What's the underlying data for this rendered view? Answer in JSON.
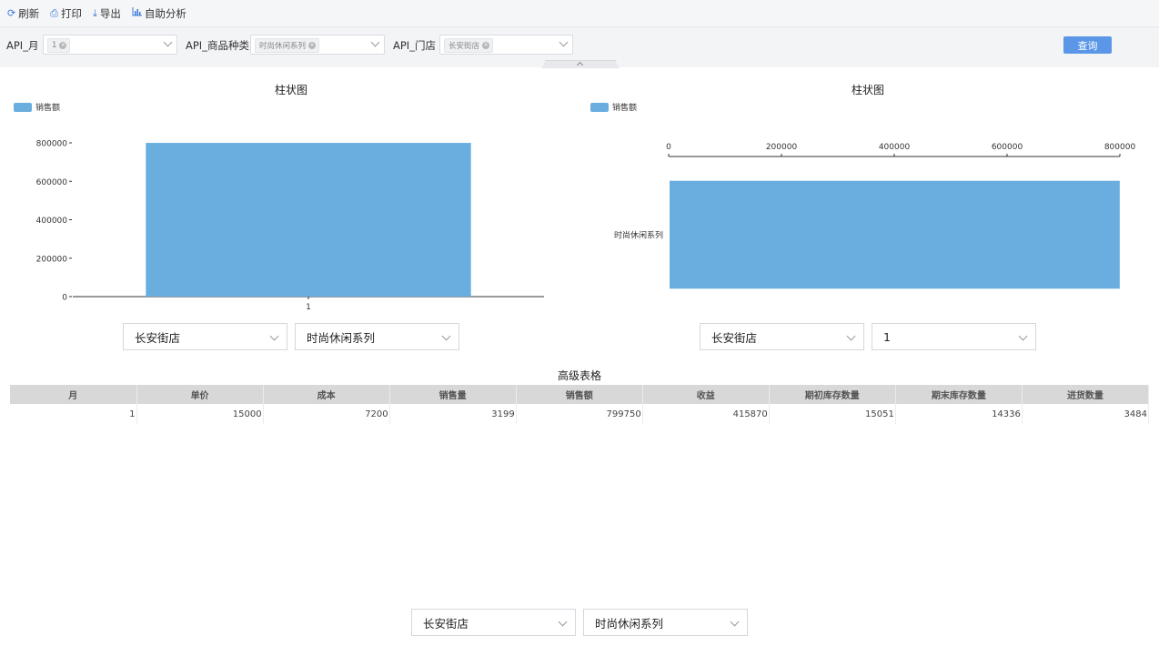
{
  "toolbar": {
    "refresh": "刷新",
    "print": "打印",
    "export": "导出",
    "self_analysis": "自助分析"
  },
  "filters": {
    "month_label": "API_月",
    "month_tag": "1",
    "category_label": "API_商品种类",
    "category_tag": "时尚休闲系列",
    "store_label": "API_门店",
    "store_tag": "长安街店",
    "query_button": "查询"
  },
  "chart_left": {
    "title": "柱状图",
    "legend": "销售额",
    "dropdown1": "长安街店",
    "dropdown2": "时尚休闲系列"
  },
  "chart_right": {
    "title": "柱状图",
    "legend": "销售额",
    "dropdown1": "长安街店",
    "dropdown2": "1"
  },
  "chart_data": [
    {
      "type": "bar",
      "orientation": "vertical",
      "title": "柱状图",
      "categories": [
        "1"
      ],
      "series": [
        {
          "name": "销售额",
          "values": [
            799750
          ]
        }
      ],
      "ylim": [
        0,
        800000
      ],
      "yticks": [
        "0",
        "200000",
        "400000",
        "600000",
        "800000"
      ],
      "color": "#6aaedf"
    },
    {
      "type": "bar",
      "orientation": "horizontal",
      "title": "柱状图",
      "categories": [
        "时尚休闲系列"
      ],
      "series": [
        {
          "name": "销售额",
          "values": [
            799750
          ]
        }
      ],
      "xlim": [
        0,
        800000
      ],
      "xticks": [
        "0",
        "200000",
        "400000",
        "600000",
        "800000"
      ],
      "color": "#6aaedf"
    }
  ],
  "table": {
    "title": "高级表格",
    "headers": [
      "月",
      "单价",
      "成本",
      "销售量",
      "销售额",
      "收益",
      "期初库存数量",
      "期末库存数量",
      "进货数量"
    ],
    "rows": [
      [
        "1",
        "15000",
        "7200",
        "3199",
        "799750",
        "415870",
        "15051",
        "14336",
        "3484"
      ]
    ]
  },
  "bottom": {
    "dropdown1": "长安街店",
    "dropdown2": "时尚休闲系列"
  }
}
